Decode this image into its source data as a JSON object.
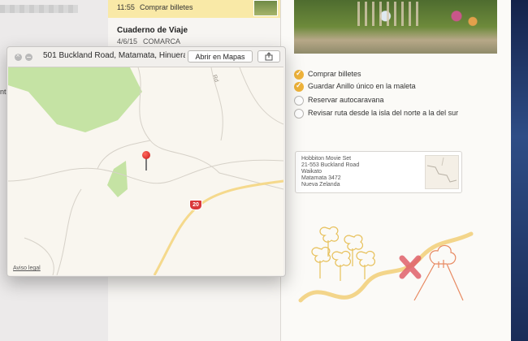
{
  "sidebar": {
    "fragment_text": "nt"
  },
  "note_list": {
    "items": [
      {
        "time": "11:55",
        "text": "Comprar billetes"
      },
      {
        "title": "Cuaderno de Viaje",
        "date": "4/6/15",
        "text": "COMARCA"
      }
    ]
  },
  "note": {
    "checklist": [
      {
        "label": "Comprar billetes",
        "done": true
      },
      {
        "label": "Guardar Anillo único en la maleta",
        "done": true
      },
      {
        "label": "Reservar autocaravana",
        "done": false
      },
      {
        "label": "Revisar ruta desde la isla del norte a la del sur",
        "done": false
      }
    ],
    "map_card": {
      "lines": [
        "Hobbiton Movie Set",
        "21-553 Buckland Road",
        "Waikato",
        "Matamata 3472",
        "Nueva Zelanda"
      ]
    }
  },
  "popover": {
    "address": "501 Buckland Road, Matamata, Hinuera…",
    "open_button": "Abrir en Mapas",
    "legal": "Aviso legal",
    "map_label": "Rd",
    "road_number": "20"
  },
  "colors": {
    "accent": "#efb33a",
    "pin": "#d9251c",
    "park": "#c5e3a4",
    "road": "#f5d98c"
  }
}
